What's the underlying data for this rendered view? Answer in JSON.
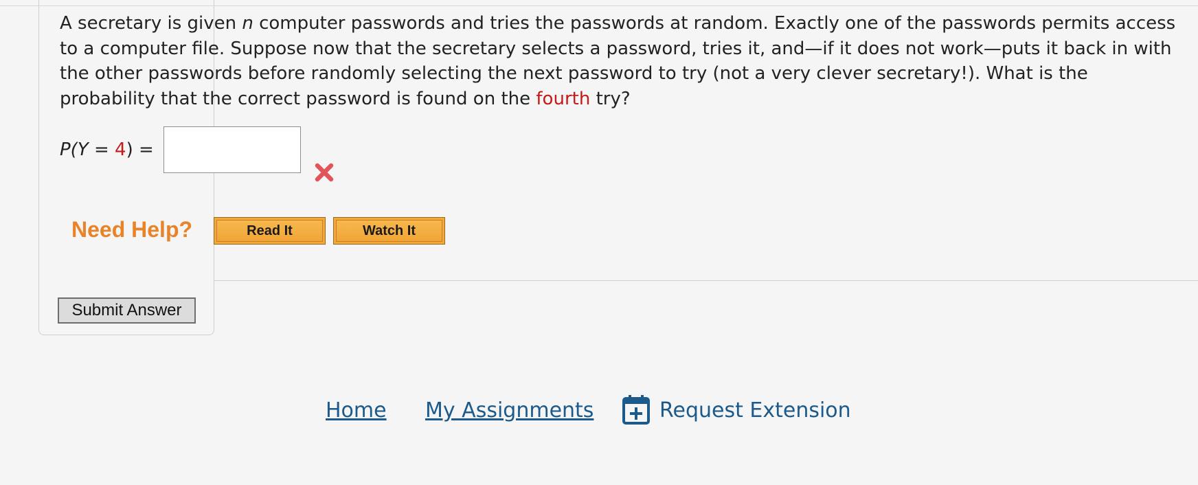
{
  "question": {
    "lines": [
      "A secretary is given ",
      "n",
      " computer passwords and tries the passwords at random. Exactly one of the passwords permits access",
      "to a computer file. Suppose now that the secretary selects a password, tries it, and—if it does not work—puts it back in with",
      "the other passwords before randomly selecting the next password to try (not a very clever secretary!). What is the",
      "probability that the correct password is found on the ",
      "fourth",
      " try?"
    ]
  },
  "answer": {
    "label_prefix": "P(",
    "label_var": "Y",
    "label_eq": " = ",
    "label_value": "4",
    "label_suffix": ") =",
    "value": "",
    "status": "incorrect"
  },
  "help": {
    "title": "Need Help?",
    "read_label": "Read It",
    "watch_label": "Watch It"
  },
  "submit": {
    "label": "Submit Answer"
  },
  "footer": {
    "home": "Home",
    "assignments": "My Assignments",
    "extension": "Request Extension"
  },
  "colors": {
    "background": "#f5f5f5",
    "highlight_red": "#c41a1a",
    "help_orange": "#e8832a",
    "button_orange": "#f4a83c",
    "link_blue": "#1b5a8a",
    "wrong_red": "#e0545a"
  },
  "icons": {
    "wrong": "x-mark-icon",
    "extension": "calendar-plus-icon"
  }
}
